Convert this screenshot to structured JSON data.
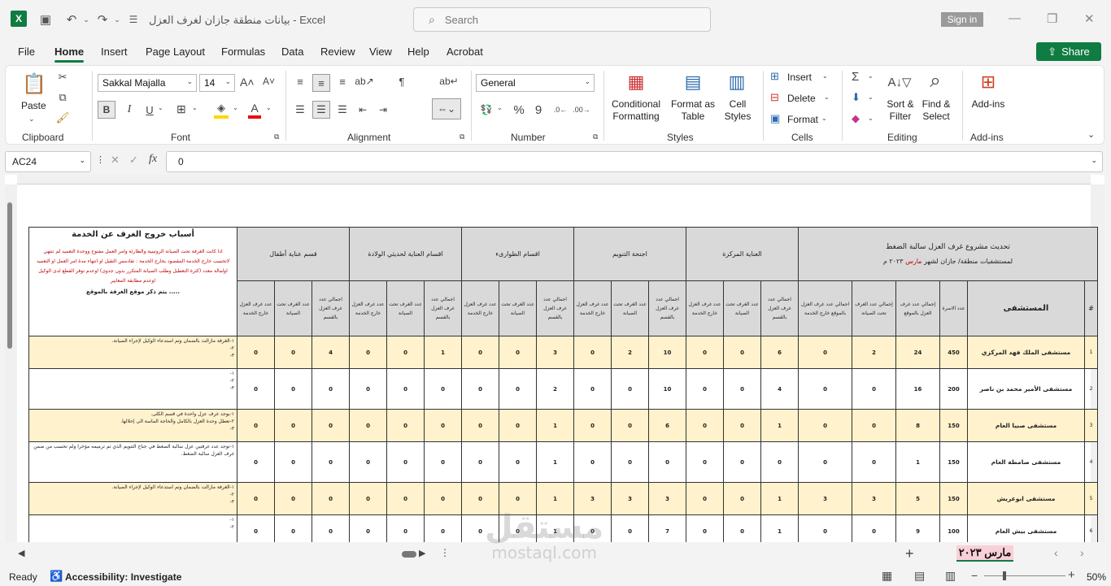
{
  "titlebar": {
    "title": "بيانات منطقة جازان لغرف العزل  -  Excel",
    "search_placeholder": "Search",
    "signin": "Sign in"
  },
  "menu": [
    "File",
    "Home",
    "Insert",
    "Page Layout",
    "Formulas",
    "Data",
    "Review",
    "View",
    "Help",
    "Acrobat"
  ],
  "share": "Share",
  "ribbon": {
    "paste": "Paste",
    "clipboard": "Clipboard",
    "font_name": "Sakkal Majalla",
    "font_size": "14",
    "font": "Font",
    "alignment": "Alignment",
    "number_format": "General",
    "number": "Number",
    "cond_fmt": "Conditional Formatting",
    "format_table": "Format as Table",
    "cell_styles": "Cell Styles",
    "styles": "Styles",
    "insert": "Insert",
    "delete": "Delete",
    "format": "Format",
    "cells": "Cells",
    "sort": "Sort & Filter",
    "find": "Find & Select",
    "editing": "Editing",
    "addins": "Add-ins",
    "addins_group": "Add-ins"
  },
  "formula_bar": {
    "name_box": "AC24",
    "value": "0"
  },
  "sheet": {
    "main_title": "تحديث مشروع غرف العزل سالبة الضغط",
    "sub_title_a": "لمستشفيات منطقة/ جازان لشهر ",
    "sub_title_month": "مارس",
    "sub_title_b": " ٢٠٢٣ م",
    "reasons_title": "أسباب خروج الغرف عن الخدمة",
    "reasons_red": "اذا كانت الغرفة تحت الصيانة الروتينية والطارئة وامر العمل مفتوح ووحدة التعميد لم تنتهي لاتحسب خارج الخدمة المقصود بخارج الخدمة : تقادمس التقيل او انتهاء مدة امر العمل او التعميد اولمالة معدد (كثرة التعطيل وطلب الصيانة المتكرر بدون جدوى) اوعدم توفر القطع لدى الوكيل اوعدم مطابقة المعايير",
    "reasons_black": "..... يتم ذكر موقع الغرفة بالموقع",
    "hospital_header": "المستشفى",
    "idx_header": "#",
    "beds_header": "عدد الاسرة",
    "total_header": "إجمالي عدد غرف العزل بالموقع",
    "maint_header": "إجمالي عدد الغرف تحت الصيانة",
    "out_header": "اجمالي عدد غرف العزل بالموقع خارج الخدمة",
    "dept_headers": [
      "العناية المركزة",
      "اجنحة التنويم",
      "اقسام الطوارىء",
      "اقسام العناية لحديثي الولادة",
      "قسم عناية أطفال"
    ],
    "sub_headers": [
      "اجمالي عدد غرف العزل بالقسم",
      "عدد الغرف تحت الصيانة",
      "عدد غرف العزل خارج الخدمة"
    ],
    "rows": [
      {
        "idx": "1",
        "hospital": "مستشفى الملك فهد المركزي",
        "beds": "450",
        "total": "24",
        "maint": "2",
        "out": "0",
        "d": [
          "6",
          "0",
          "0",
          "10",
          "2",
          "0",
          "3",
          "0",
          "0",
          "1",
          "0",
          "0",
          "4",
          "0",
          "0"
        ],
        "notes": [
          "١-الغرفة مازالت بالضمان وتم استدعاء الوكيل لإجراء الصيانة.",
          "٢-",
          "٣-"
        ]
      },
      {
        "idx": "2",
        "hospital": "مستشفى الأمير محمد بن ناصر",
        "beds": "200",
        "total": "16",
        "maint": "0",
        "out": "0",
        "d": [
          "4",
          "0",
          "0",
          "10",
          "0",
          "0",
          "2",
          "0",
          "0",
          "0",
          "0",
          "0",
          "0",
          "0",
          "0"
        ],
        "notes": [
          "١-",
          "٢-",
          "٣-"
        ]
      },
      {
        "idx": "3",
        "hospital": "مستشفى صبيا العام",
        "beds": "150",
        "total": "8",
        "maint": "0",
        "out": "0",
        "d": [
          "1",
          "0",
          "0",
          "6",
          "0",
          "0",
          "1",
          "0",
          "0",
          "0",
          "0",
          "0",
          "0",
          "0",
          "0"
        ],
        "notes": [
          "١-يوجد غرف عزل واحدة في قسم الكلى.",
          "٢-تعطل وحدة العزل بالكامل والحاجة الماسة الى إحلالها.",
          "٣-"
        ]
      },
      {
        "idx": "4",
        "hospital": "مستشفى صامطة العام",
        "beds": "150",
        "total": "1",
        "maint": "0",
        "out": "0",
        "d": [
          "0",
          "0",
          "0",
          "0",
          "0",
          "0",
          "1",
          "0",
          "0",
          "0",
          "0",
          "0",
          "0",
          "0",
          "0"
        ],
        "notes": [
          "١-توجد عدد غرفتين عزل سالبة الضغط في جناح التنويم الذي تم ترميمه مؤخرا ولم تحسب من ضمن غرف العزل سالبة الضغط.",
          "",
          ""
        ]
      },
      {
        "idx": "5",
        "hospital": "مستشفى ابوعريش",
        "beds": "150",
        "total": "5",
        "maint": "3",
        "out": "3",
        "d": [
          "1",
          "0",
          "0",
          "3",
          "3",
          "3",
          "1",
          "0",
          "0",
          "0",
          "0",
          "0",
          "0",
          "0",
          "0"
        ],
        "notes": [
          "١-الغرفة مازالت بالضمان وتم استدعاء الوكيل لإجراء الصيانة.",
          "٢-",
          "٣-"
        ]
      },
      {
        "idx": "6",
        "hospital": "مستشفى بيش العام",
        "beds": "100",
        "total": "9",
        "maint": "0",
        "out": "0",
        "d": [
          "1",
          "0",
          "0",
          "7",
          "0",
          "0",
          "1",
          "0",
          "0",
          "0",
          "0",
          "0",
          "0",
          "0",
          "0"
        ],
        "notes": [
          "١-",
          "٢-"
        ]
      }
    ]
  },
  "tabs": {
    "active": "مارس ٢٠٢٣"
  },
  "status": {
    "ready": "Ready",
    "accessibility": "Accessibility: Investigate",
    "zoom": "50%"
  },
  "watermark": {
    "ar": "مستقل",
    "en": "mostaql.com"
  }
}
